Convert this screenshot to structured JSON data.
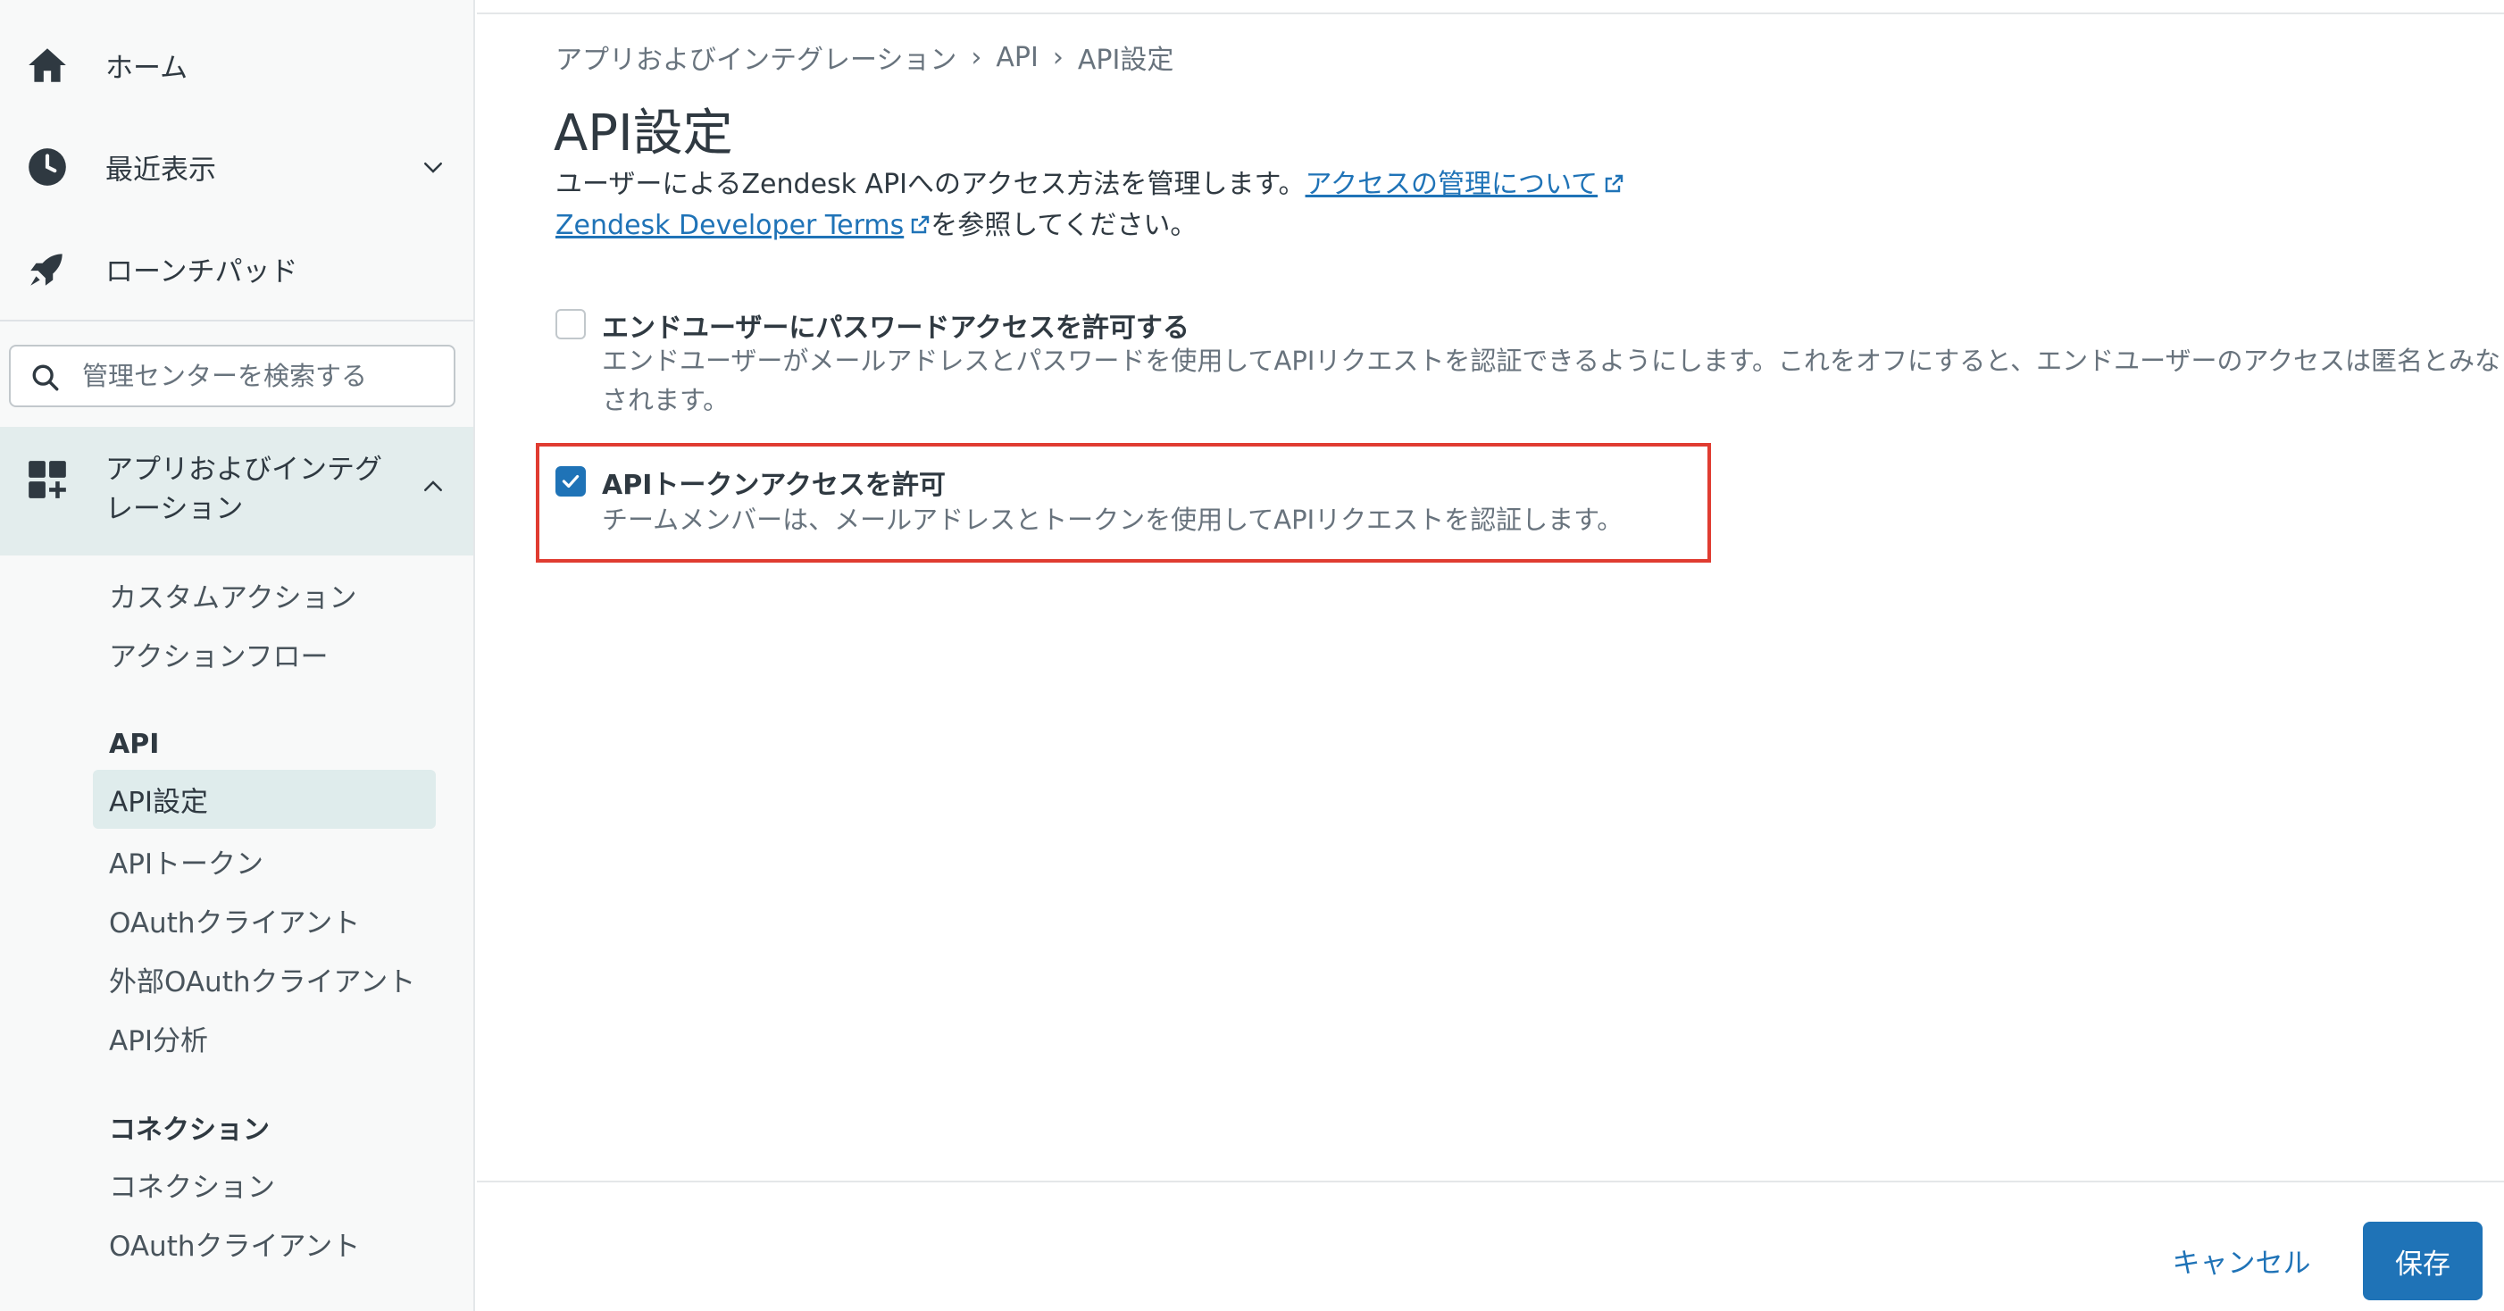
{
  "sidebar": {
    "nav": [
      {
        "label": "ホーム",
        "icon": "home-icon"
      },
      {
        "label": "最近表示",
        "icon": "clock-icon"
      },
      {
        "label": "ローンチパッド",
        "icon": "rocket-icon"
      }
    ],
    "search": {
      "placeholder": "管理センターを検索する"
    },
    "active_section": {
      "label": "アプリおよびインテグレーション",
      "icon": "apps-add-icon"
    },
    "sub_items": {
      "custom_actions": "カスタムアクション",
      "action_flows": "アクションフロー",
      "api_heading": "API",
      "api_settings": "API設定",
      "api_tokens": "APIトークン",
      "oauth_clients": "OAuthクライアント",
      "external_oauth_clients": "外部OAuthクライアント",
      "api_analytics": "API分析",
      "connections_heading": "コネクション",
      "connections": "コネクション",
      "connections_oauth_clients": "OAuthクライアント"
    }
  },
  "breadcrumb": [
    "アプリおよびインテグレーション",
    "API",
    "API設定"
  ],
  "page": {
    "title": "API設定",
    "description_prefix": "ユーザーによるZendesk APIへのアクセス方法を管理します。",
    "manage_access_link": "アクセスの管理について",
    "developer_terms_link": "Zendesk Developer Terms",
    "description_suffix": "を参照してください。"
  },
  "options": [
    {
      "title": "エンドユーザーにパスワードアクセスを許可する",
      "description": "エンドユーザーがメールアドレスとパスワードを使用してAPIリクエストを認証できるようにします。これをオフにすると、エンドユーザーのアクセスは匿名とみなされます。",
      "checked": false
    },
    {
      "title": "APIトークンアクセスを許可",
      "description": "チームメンバーは、メールアドレスとトークンを使用してAPIリクエストを認証します。",
      "checked": true
    }
  ],
  "footer": {
    "cancel_label": "キャンセル",
    "save_label": "保存"
  },
  "colors": {
    "accent": "#1f73b7",
    "highlight": "#e03c31",
    "sidebar_active": "#e3eded"
  }
}
